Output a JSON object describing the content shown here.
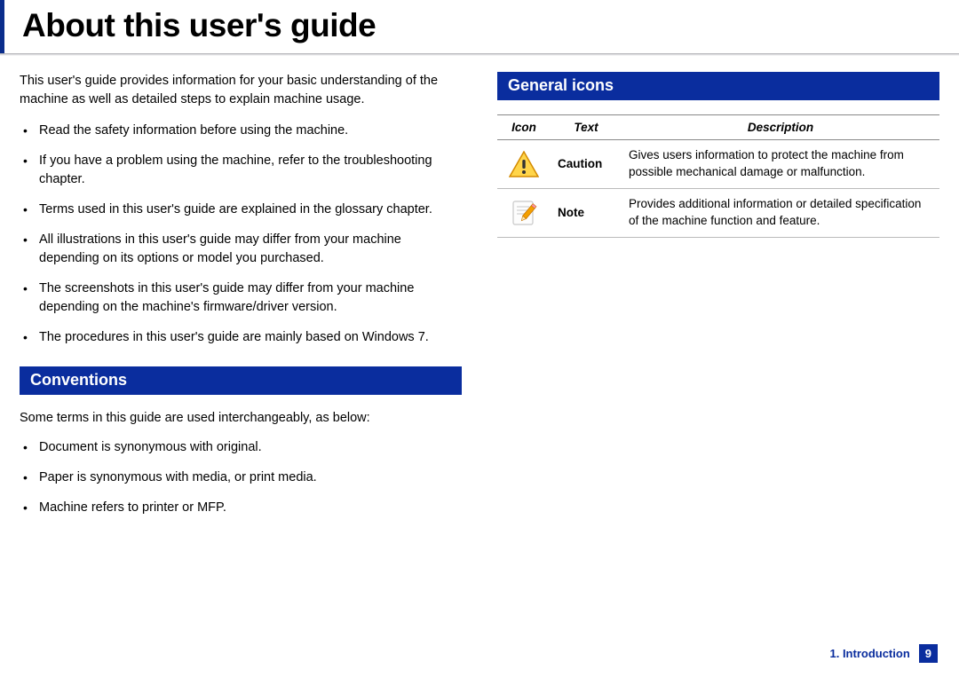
{
  "title": "About this user's guide",
  "intro": "This user's guide provides information for your basic understanding of the machine as well as detailed steps to explain machine usage.",
  "bullets": [
    "Read the safety information before using the machine.",
    "If you have a problem using the machine, refer to the troubleshooting chapter.",
    "Terms used in this user's guide are explained in the glossary chapter.",
    "All illustrations in this user's guide may differ from your machine depending on its options or model you purchased.",
    "The screenshots in this user's guide may differ from your machine depending on the machine's firmware/driver version.",
    "The procedures in this user's guide are mainly based on Windows 7."
  ],
  "sections": {
    "conventions": {
      "heading": "Conventions",
      "lead": "Some terms in this guide are used interchangeably, as below:",
      "items": [
        "Document is synonymous with original.",
        "Paper is synonymous with media, or print media.",
        "Machine refers to printer or MFP."
      ]
    },
    "general_icons": {
      "heading": "General icons",
      "table": {
        "headers": {
          "icon": "Icon",
          "text": "Text",
          "description": "Description"
        },
        "rows": [
          {
            "icon_name": "caution-icon",
            "text": "Caution",
            "description": "Gives users information to protect the machine from possible mechanical damage or malfunction."
          },
          {
            "icon_name": "note-icon",
            "text": "Note",
            "description": "Provides additional information or detailed specification of the machine function and feature."
          }
        ]
      }
    }
  },
  "footer": {
    "chapter": "1. Introduction",
    "page": "9"
  }
}
